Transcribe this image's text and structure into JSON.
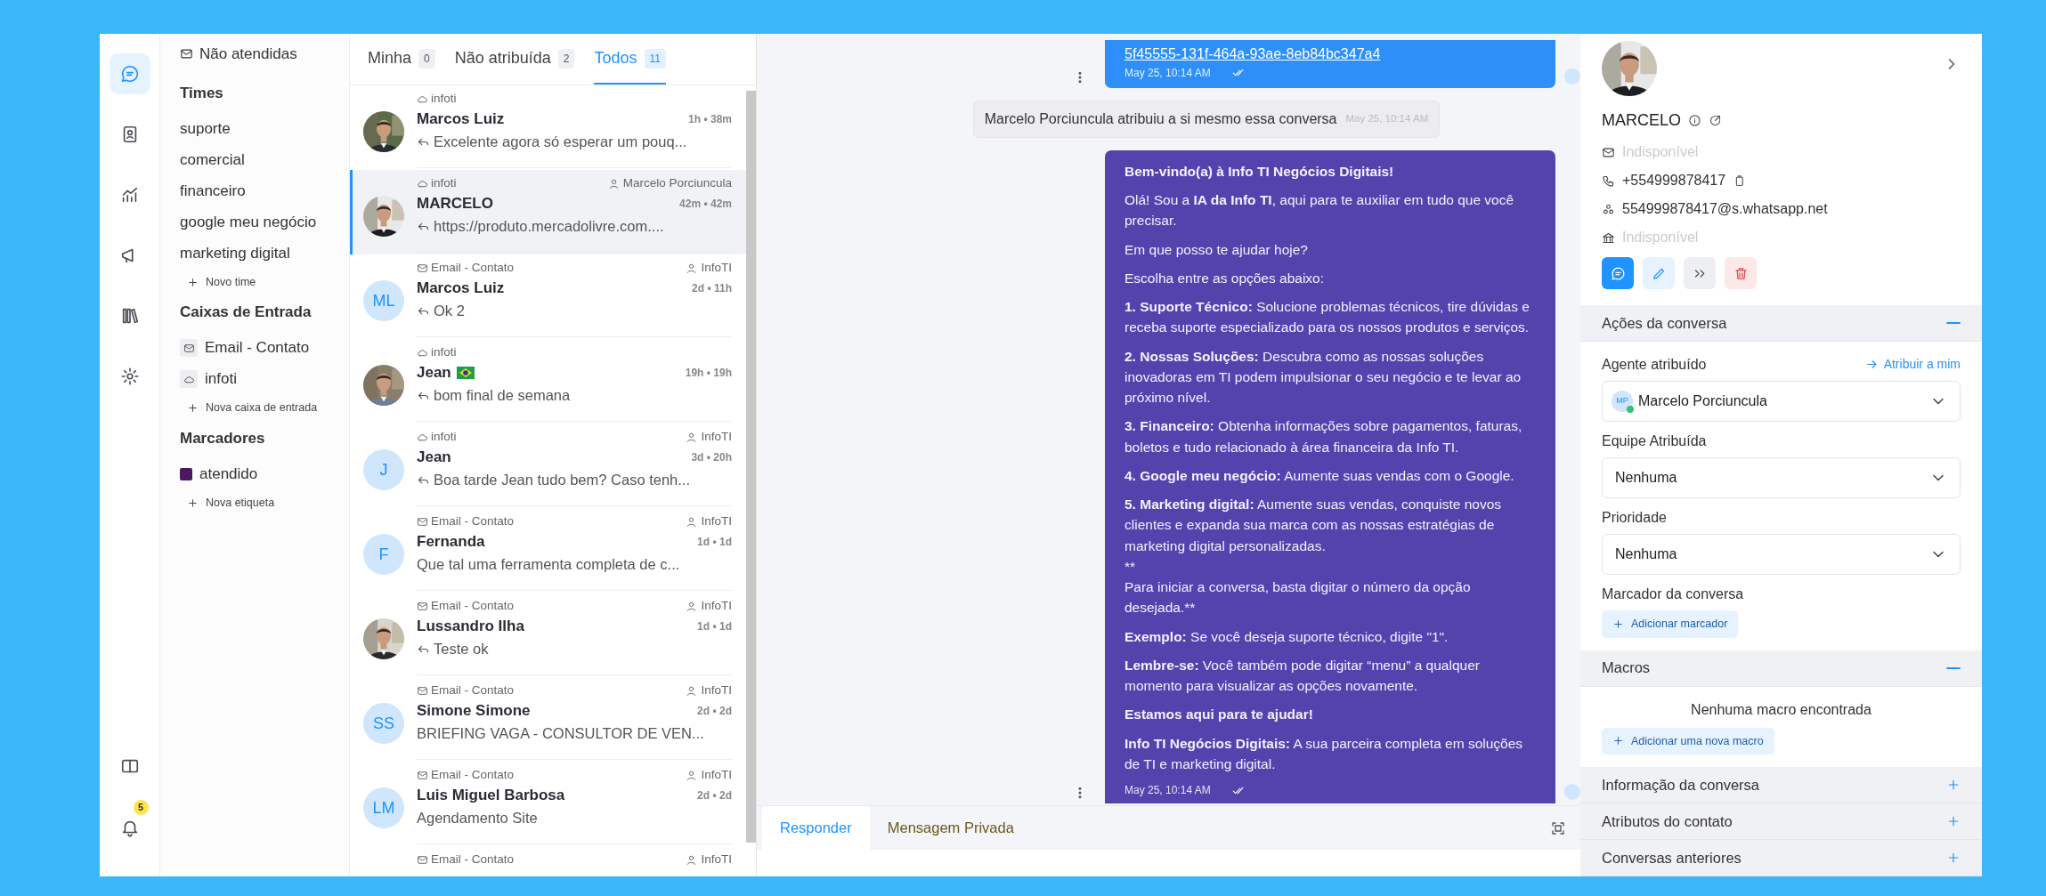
{
  "rail": {
    "items": [
      {
        "selected": true
      },
      {
        "selected": false
      },
      {
        "selected": false
      },
      {
        "selected": false
      },
      {
        "selected": false
      },
      {
        "selected": false
      }
    ],
    "notification_count": "5"
  },
  "sidebar": {
    "top_item": "Não atendidas",
    "sections": [
      {
        "title": "Times",
        "items": [
          {
            "label": "suporte",
            "kind": "team"
          },
          {
            "label": "comercial",
            "kind": "team"
          },
          {
            "label": "financeiro",
            "kind": "team"
          },
          {
            "label": "google meu negócio",
            "kind": "team"
          },
          {
            "label": "marketing digital",
            "kind": "team"
          }
        ],
        "add_label": "Novo time"
      },
      {
        "title": "Caixas de Entrada",
        "items": [
          {
            "label": "Email - Contato",
            "kind": "email"
          },
          {
            "label": "infoti",
            "kind": "api"
          }
        ],
        "add_label": "Nova caixa de entrada"
      },
      {
        "title": "Marcadores",
        "items": [
          {
            "label": "atendido",
            "kind": "tag",
            "color": "#4b1a5e"
          }
        ],
        "add_label": "Nova etiqueta"
      }
    ]
  },
  "conversation_list": {
    "tabs": [
      {
        "label": "Minha",
        "count": "0",
        "selected": false
      },
      {
        "label": "Não atribuída",
        "count": "2",
        "selected": false
      },
      {
        "label": "Todos",
        "count": "11",
        "selected": true
      }
    ],
    "items": [
      {
        "inbox": {
          "kind": "api",
          "label": "infoti"
        },
        "name": "Marcos Luiz",
        "time": "1h • 38m",
        "preview": "Excelente agora só esperar um pouq...",
        "replied": true,
        "selected": false
      },
      {
        "inbox": {
          "kind": "api",
          "label": "infoti"
        },
        "assignee": "Marcelo Porciuncula",
        "name": "MARCELO",
        "time": "42m • 42m",
        "preview": "https://produto.mercadolivre.com....",
        "replied": true,
        "selected": true
      },
      {
        "inbox": {
          "kind": "email",
          "label": "Email - Contato"
        },
        "assignee": "InfoTI",
        "name": "Marcos Luiz",
        "time": "2d • 11h",
        "preview": "Ok 2",
        "replied": true,
        "avatar": {
          "kind": "initials",
          "text": "ML"
        },
        "selected": false
      },
      {
        "inbox": {
          "kind": "api",
          "label": "infoti"
        },
        "name": "Jean",
        "flag": true,
        "time": "19h • 19h",
        "preview": "bom final de semana",
        "replied": true,
        "selected": false
      },
      {
        "inbox": {
          "kind": "api",
          "label": "infoti"
        },
        "assignee": "InfoTI",
        "name": "Jean",
        "time": "3d • 20h",
        "preview": "Boa tarde Jean tudo bem? Caso tenh...",
        "replied": true,
        "avatar": {
          "kind": "initials",
          "text": "J"
        },
        "selected": false
      },
      {
        "inbox": {
          "kind": "email",
          "label": "Email - Contato"
        },
        "assignee": "InfoTI",
        "name": "Fernanda",
        "time": "1d • 1d",
        "preview": "Que tal uma ferramenta completa de c...",
        "replied": false,
        "avatar": {
          "kind": "initials",
          "text": "F"
        },
        "selected": false
      },
      {
        "inbox": {
          "kind": "email",
          "label": "Email - Contato"
        },
        "assignee": "InfoTI",
        "name": "Lussandro Ilha",
        "time": "1d • 1d",
        "preview": "Teste ok",
        "replied": true,
        "selected": false
      },
      {
        "inbox": {
          "kind": "email",
          "label": "Email - Contato"
        },
        "assignee": "InfoTI",
        "name": "Simone Simone",
        "time": "2d • 2d",
        "preview": "BRIEFING VAGA - CONSULTOR DE VEN...",
        "replied": false,
        "avatar": {
          "kind": "initials",
          "text": "SS"
        },
        "selected": false
      },
      {
        "inbox": {
          "kind": "email",
          "label": "Email - Contato"
        },
        "assignee": "InfoTI",
        "name": "Luis Miguel Barbosa",
        "time": "2d • 2d",
        "preview": "Agendamento Site",
        "replied": false,
        "avatar": {
          "kind": "initials",
          "text": "LM"
        },
        "selected": false
      },
      {
        "inbox": {
          "kind": "email",
          "label": "Email - Contato"
        },
        "assignee": "InfoTI",
        "selected": false
      }
    ]
  },
  "chat": {
    "top_message": {
      "link": "5f45555-131f-464a-93ae-8eb84bc347a4",
      "time": "May 25, 10:14 AM"
    },
    "activity": {
      "text": "Marcelo Porciuncula atribuiu a si mesmo essa conversa",
      "time": "May 25, 10:14 AM"
    },
    "message": {
      "time": "May 25, 10:14 AM",
      "paragraphs": [
        {
          "kind": "heading",
          "text": "Bem-vindo(a) à Info TI Negócios Digitais!"
        },
        {
          "kind": "rich",
          "text": "Olá! Sou a **IA da Info TI**, aqui para te auxiliar em tudo que você precisar."
        },
        {
          "kind": "plain",
          "text": "Em que posso te ajudar hoje?"
        },
        {
          "kind": "plain",
          "text": "Escolha entre as opções abaixo:"
        },
        {
          "kind": "rich",
          "text": "**1. Suporte Técnico:** Solucione problemas técnicos, tire dúvidas e receba suporte especializado para os nossos produtos e serviços."
        },
        {
          "kind": "rich",
          "text": "**2. Nossas Soluções:** Descubra como as nossas soluções inovadoras em TI podem impulsionar o seu negócio e te levar ao próximo nível."
        },
        {
          "kind": "rich",
          "text": "**3. Financeiro:** Obtenha informações sobre pagamentos, faturas, boletos e tudo relacionado à área financeira da Info TI."
        },
        {
          "kind": "rich",
          "text": "**4. Google meu negócio:** Aumente suas vendas com o Google."
        },
        {
          "kind": "rich",
          "text": "**5. Marketing digital:** Aumente suas vendas, conquiste novos clientes e expanda sua marca com as nossas estratégias de marketing digital personalizadas."
        },
        {
          "kind": "plain",
          "text": "**"
        },
        {
          "kind": "plain",
          "text": "Para iniciar a conversa, basta digitar o número da opção desejada.**"
        },
        {
          "kind": "rich",
          "text": "**Exemplo:** Se você deseja suporte técnico, digite \"1\"."
        },
        {
          "kind": "rich",
          "text": "**Lembre-se:** Você também pode digitar “menu” a qualquer momento para visualizar as opções novamente."
        },
        {
          "kind": "heading",
          "text": "Estamos aqui para te ajudar!"
        },
        {
          "kind": "rich",
          "text": "**Info TI Negócios Digitais:** A sua parceira completa em soluções de TI e marketing digital."
        }
      ]
    },
    "composer_tabs": [
      {
        "label": "Responder",
        "selected": true
      },
      {
        "label": "Mensagem Privada",
        "selected": false
      }
    ]
  },
  "contact": {
    "name": "MARCELO",
    "fields": [
      {
        "kind": "email",
        "value": "Indisponível",
        "available": false
      },
      {
        "kind": "phone",
        "value": "+554999878417",
        "available": true
      },
      {
        "kind": "identifier",
        "value": "554999878417@s.whatsapp.net",
        "available": true
      },
      {
        "kind": "company",
        "value": "Indisponível",
        "available": false
      }
    ],
    "sections": [
      {
        "kind": "actions",
        "title": "Ações da conversa",
        "expanded": true,
        "agent": {
          "label": "Agente atribuído",
          "link": "Atribuir a mim",
          "value": "Marcelo Porciuncula",
          "initials": "MP",
          "online": true
        },
        "team": {
          "label": "Equipe Atribuída",
          "value": "Nenhuma"
        },
        "priority": {
          "label": "Prioridade",
          "value": "Nenhuma"
        },
        "tags": {
          "label": "Marcador da conversa",
          "button": "Adicionar marcador"
        }
      },
      {
        "kind": "macros",
        "title": "Macros",
        "expanded": true,
        "empty": "Nenhuma macro encontrada",
        "button": "Adicionar uma nova macro"
      },
      {
        "title": "Informação da conversa",
        "expanded": false
      },
      {
        "title": "Atributos do contato",
        "expanded": false
      },
      {
        "title": "Conversas anteriores",
        "expanded": false
      }
    ]
  }
}
